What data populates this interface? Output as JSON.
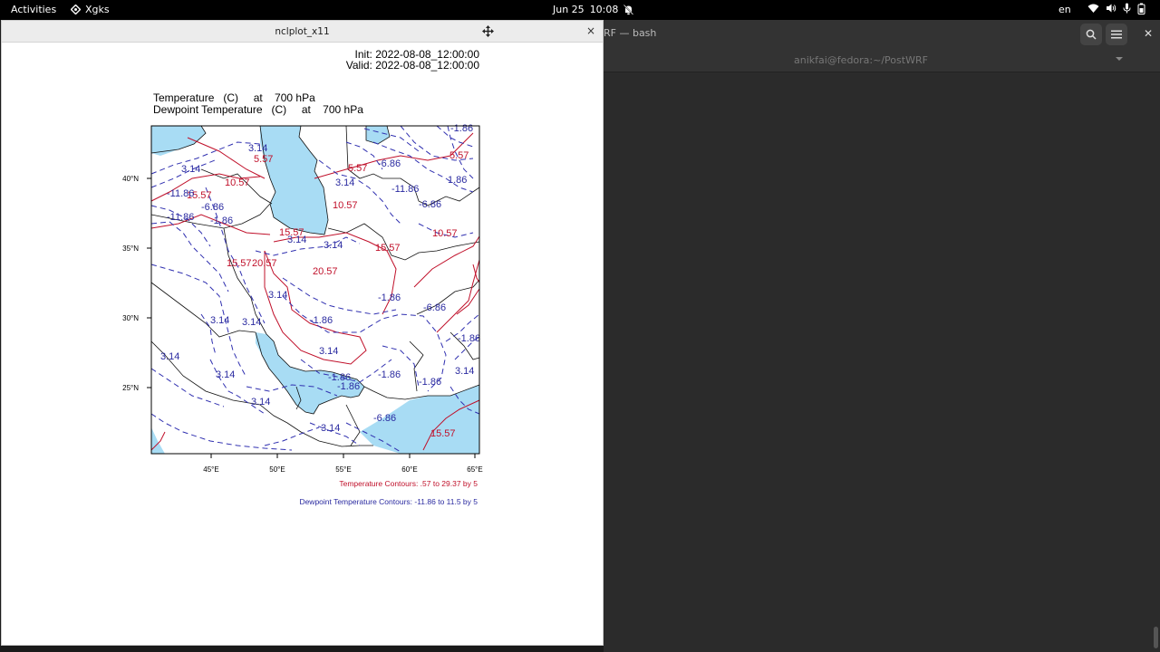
{
  "topbar": {
    "activities": "Activities",
    "app_name": "Xgks",
    "date": "Jun 25",
    "time": "10:08",
    "lang": "en"
  },
  "terminal": {
    "title": "RF — bash",
    "subtitle": "anikfai@fedora:~/PostWRF"
  },
  "window": {
    "title": "nclplot_x11",
    "close": "×"
  },
  "plot": {
    "init": "Init: 2022-08-08_12:00:00",
    "valid": "Valid: 2022-08-08_12:00:00",
    "title1": "Temperature   (C)     at    700 hPa",
    "title2": "Dewpoint Temperature   (C)     at    700 hPa",
    "lat_ticks": [
      "40°N",
      "35°N",
      "30°N",
      "25°N"
    ],
    "lon_ticks": [
      "45°E",
      "50°E",
      "55°E",
      "60°E",
      "65°E"
    ],
    "temp_note": "Temperature Contours: .57 to 29.37 by 5",
    "dew_note": "Dewpoint Temperature Contours: -11.86 to 11.5 by 5",
    "temp_labels": [
      "5.57",
      "5.57",
      "10.57",
      "15.57",
      "10.57",
      "15.57",
      "10.57",
      "15.57",
      "20.57",
      "20.57",
      "15.57",
      "5.57",
      "15.57"
    ],
    "dew_labels": [
      "3.14",
      "3.14",
      "-11.86",
      "-6.86",
      "-11.86",
      "-1.86",
      "3.14",
      "3.14",
      "-1.86",
      "3.14",
      "-1.86",
      "-6.86",
      "3.14",
      "-1.86",
      "3.14",
      "3.14",
      "-1.86",
      "-1.86",
      "-1.86",
      "3.14",
      "3.14",
      "-6.86",
      "3.14",
      "-1.86",
      "-6.86",
      "-11.86",
      "-6.86",
      "3.14",
      "1.86",
      "-1.86",
      "3.14",
      "3.14"
    ],
    "colors": {
      "temp": "#c0102a",
      "dew": "#2a2aa0",
      "water": "#a8dcf4"
    }
  }
}
